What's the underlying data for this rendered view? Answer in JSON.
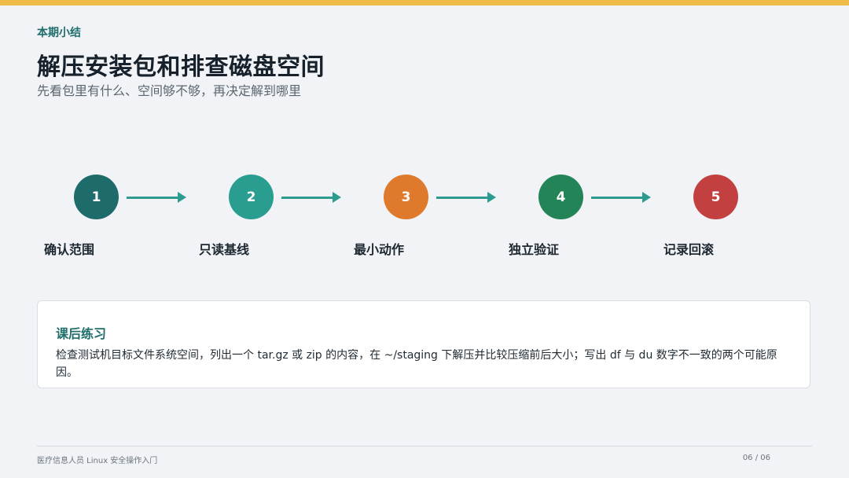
{
  "header": {
    "kicker": "本期小结",
    "title": "解压安装包和排查磁盘空间",
    "subtitle": "先看包里有什么、空间够不够，再决定解到哪里"
  },
  "flow": {
    "steps": [
      {
        "number": "1",
        "label": "确认范围",
        "color": "#1d6b6a"
      },
      {
        "number": "2",
        "label": "只读基线",
        "color": "#2a9d91"
      },
      {
        "number": "3",
        "label": "最小动作",
        "color": "#df7a2c"
      },
      {
        "number": "4",
        "label": "独立验证",
        "color": "#238458"
      },
      {
        "number": "5",
        "label": "记录回滚",
        "color": "#c34040"
      }
    ],
    "arrow_color": "#2e9b90"
  },
  "exercise": {
    "title": "课后练习",
    "body": "检查测试机目标文件系统空间，列出一个 tar.gz 或 zip 的内容，在 ~/staging 下解压并比较压缩前后大小；写出 df 与 du 数字不一致的两个可能原因。"
  },
  "footer": {
    "course": "医疗信息人员 Linux 安全操作入门",
    "page": "06 / 06"
  },
  "colors": {
    "accent_bar": "#efbc4a",
    "accent_text": "#1f6e6b",
    "background": "#f1f3f6"
  }
}
